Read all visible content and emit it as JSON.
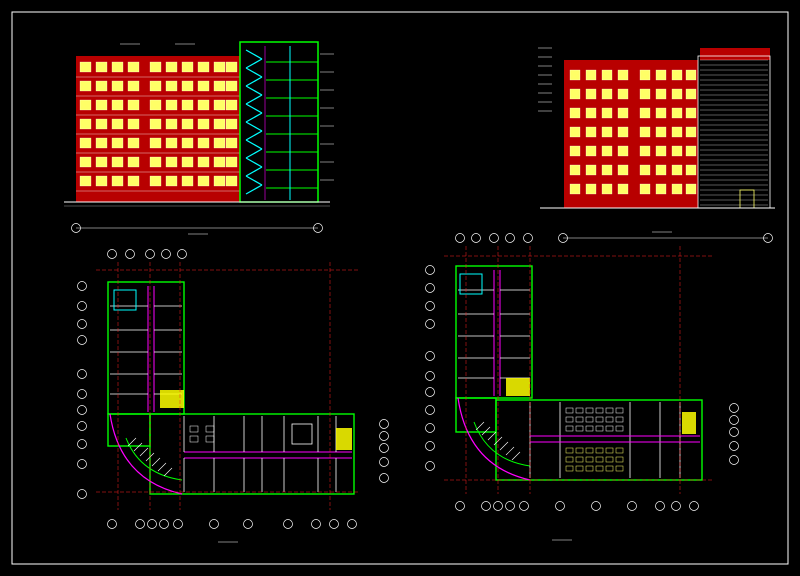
{
  "drawing": {
    "background": "#000000",
    "frame_color": "#ffffff",
    "colors": {
      "brick": "#b80000",
      "window": "#ffff66",
      "green": "#00ff00",
      "magenta": "#ff00ff",
      "cyan": "#00ffff",
      "white": "#ffffff",
      "yellow": "#ffff00",
      "red_axis": "#ff2020",
      "grey": "#9a9a9a"
    },
    "titles": {
      "front_elevation": "",
      "side_elevation": "",
      "plan_left": "",
      "plan_right": ""
    }
  }
}
